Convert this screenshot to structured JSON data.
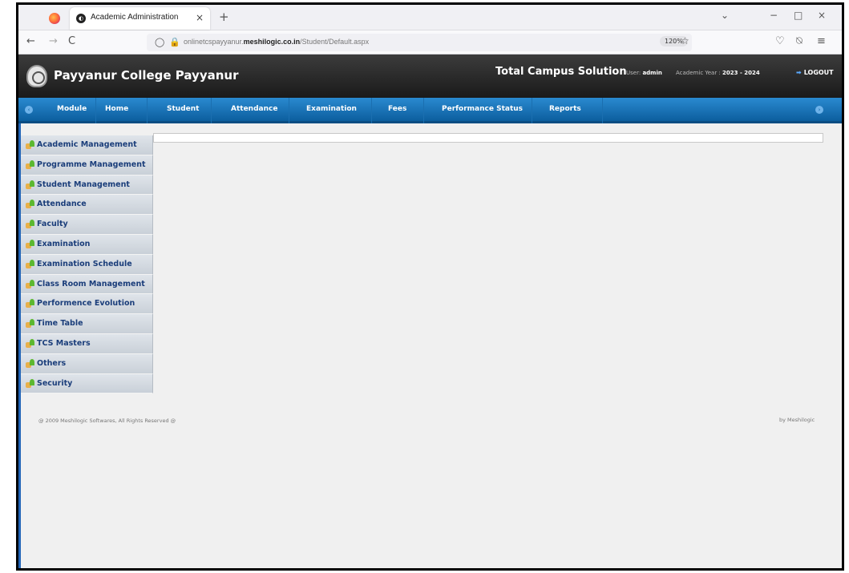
{
  "browser": {
    "tab_title": "Academic Administration",
    "tab_close": "×",
    "new_tab": "+",
    "url_prefix": "onlinetcspayyanur.",
    "url_domain": "meshilogic.co.in",
    "url_path": "/Student/Default.aspx",
    "zoom": "120%",
    "back_icon": "←",
    "forward_icon": "→",
    "reload_icon": "C",
    "shield_icon": "◯",
    "lock_icon": "🔒",
    "star_icon": "☆",
    "pocket_icon": "♡",
    "extensions_icon": "⍉",
    "menu_icon": "≡",
    "list_icon": "⌄",
    "minimize_icon": "−",
    "maximize_icon": "□",
    "close_icon": "×"
  },
  "header": {
    "college_name": "Payyanur College Payyanur",
    "product_title": "Total Campus Solution",
    "user_label": "User:",
    "user_name": "admin",
    "academic_label": "Academic Year :",
    "academic_year": "2023 - 2024",
    "logout_label": "LOGOUT",
    "logout_icon": "➡"
  },
  "menu": {
    "items": [
      {
        "label": "Module"
      },
      {
        "label": "Home"
      },
      {
        "label": "Student"
      },
      {
        "label": "Attendance"
      },
      {
        "label": "Examination"
      },
      {
        "label": "Fees"
      },
      {
        "label": "Performance Status"
      },
      {
        "label": "Reports"
      }
    ],
    "scroll_left_icon": "‹",
    "scroll_right_icon": "›"
  },
  "sidebar": {
    "items": [
      {
        "label": "Academic Management"
      },
      {
        "label": "Programme Management"
      },
      {
        "label": "Student Management"
      },
      {
        "label": "Attendance"
      },
      {
        "label": "Faculty"
      },
      {
        "label": "Examination"
      },
      {
        "label": "Examination Schedule"
      },
      {
        "label": "Class Room Management"
      },
      {
        "label": "Performence Evolution"
      },
      {
        "label": "Time Table"
      },
      {
        "label": "TCS Masters"
      },
      {
        "label": "Others"
      },
      {
        "label": "Security"
      }
    ]
  },
  "footer": {
    "copyright": "@ 2009 Meshilogic Softwares, All Rights Reserved @",
    "credit": "by Meshilogic"
  },
  "colors": {
    "menu_blue": "#0c5e9e",
    "header_dark": "#1a1a1a",
    "sidebar_text": "#1a3d7a"
  }
}
